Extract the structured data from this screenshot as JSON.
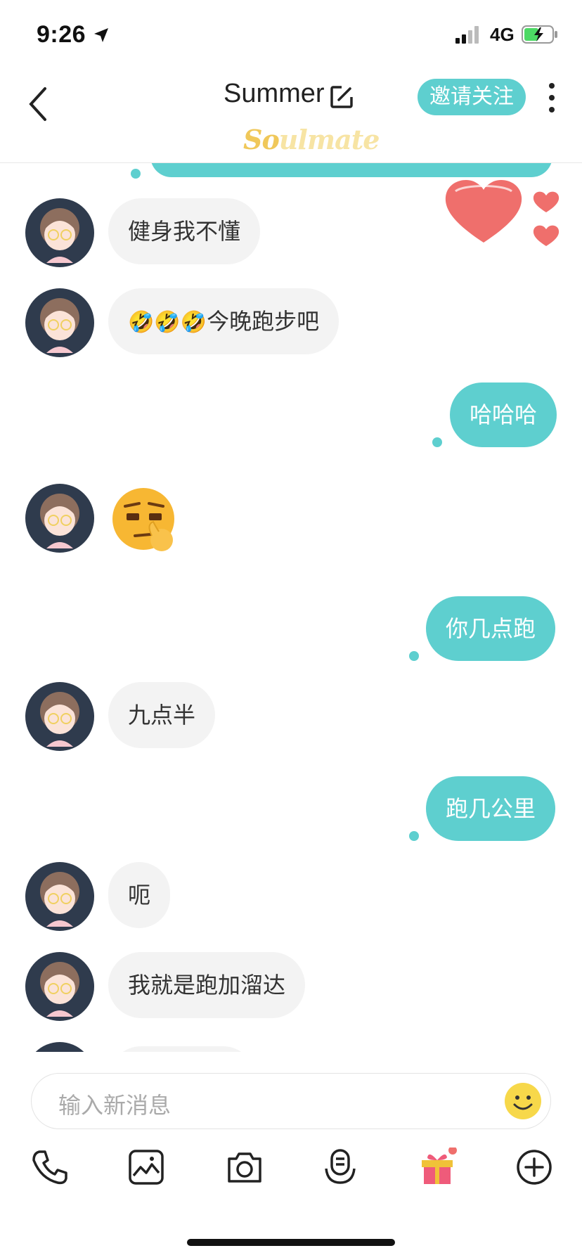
{
  "status": {
    "time": "9:26",
    "network": "4G"
  },
  "header": {
    "title": "Summer",
    "follow_label": "邀请关注",
    "brand_a": "So",
    "brand_b": "ulmate"
  },
  "messages": [
    {
      "side": "in",
      "text": "健身我不懂"
    },
    {
      "side": "in",
      "emoji_prefix": "🤣🤣🤣",
      "text": "今晚跑步吧"
    },
    {
      "side": "out",
      "text": "哈哈哈"
    },
    {
      "side": "in",
      "type": "emoji",
      "icon": "thinking-face-icon"
    },
    {
      "side": "out",
      "text": "你几点跑"
    },
    {
      "side": "in",
      "text": "九点半"
    },
    {
      "side": "out",
      "text": "跑几公里"
    },
    {
      "side": "in",
      "text": "呃"
    },
    {
      "side": "in",
      "text": "我就是跑加溜达"
    }
  ],
  "input": {
    "placeholder": "输入新消息"
  },
  "toolbar": [
    "phone-icon",
    "image-icon",
    "camera-icon",
    "voice-icon",
    "gift-icon",
    "add-icon"
  ],
  "colors": {
    "accent": "#5ecfcf",
    "incoming_bubble": "#f3f3f3",
    "heart": "#ef6f6c"
  }
}
